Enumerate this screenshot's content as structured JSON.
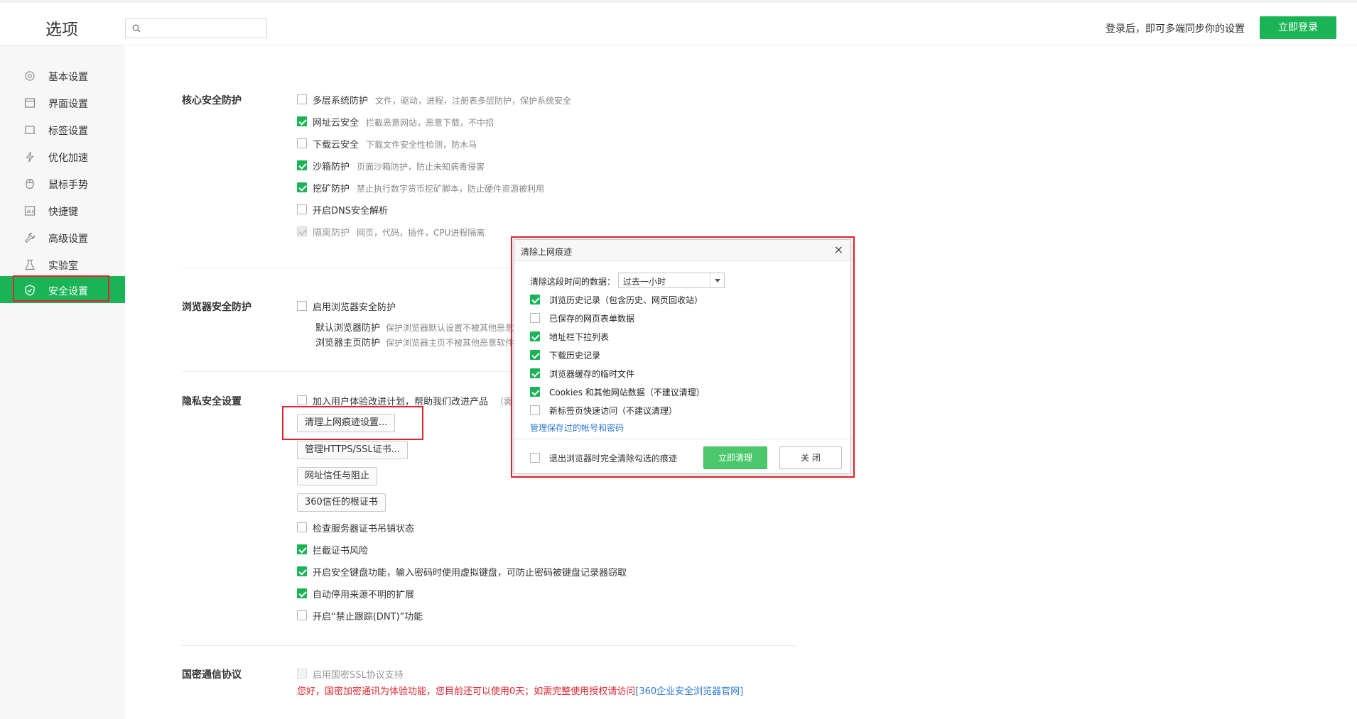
{
  "header": {
    "title": "选项",
    "search_placeholder": "",
    "login_hint": "登录后，即可多端同步你的设置",
    "login_button": "立即登录"
  },
  "sidebar": {
    "items": [
      {
        "label": "基本设置",
        "icon": "gear-icon"
      },
      {
        "label": "界面设置",
        "icon": "window-icon"
      },
      {
        "label": "标签设置",
        "icon": "tab-icon"
      },
      {
        "label": "优化加速",
        "icon": "lightning-icon"
      },
      {
        "label": "鼠标手势",
        "icon": "mouse-icon"
      },
      {
        "label": "快捷键",
        "icon": "keyboard-icon"
      },
      {
        "label": "高级设置",
        "icon": "wrench-icon"
      },
      {
        "label": "实验室",
        "icon": "flask-icon"
      },
      {
        "label": "安全设置",
        "icon": "shield-icon",
        "active": true
      }
    ]
  },
  "core": {
    "title": "核心安全防护",
    "options": [
      {
        "label": "多层系统防护",
        "desc": "文件，驱动，进程，注册表多层防护，保护系统安全",
        "checked": false
      },
      {
        "label": "网址云安全",
        "desc": "拦截恶意网站，恶意下载，不中招",
        "checked": true
      },
      {
        "label": "下载云安全",
        "desc": "下载文件安全性检测，防木马",
        "checked": false
      },
      {
        "label": "沙箱防护",
        "desc": "页面沙箱防护，防止未知病毒侵害",
        "checked": true
      },
      {
        "label": "挖矿防护",
        "desc": "禁止执行数字货币挖矿脚本，防止硬件资源被利用",
        "checked": true
      },
      {
        "label": "开启DNS安全解析",
        "desc": "",
        "checked": false
      },
      {
        "label": "隔离防护",
        "desc": "网页，代码，插件，CPU进程隔离",
        "checked": true,
        "disabled": true
      }
    ]
  },
  "browser": {
    "title": "浏览器安全防护",
    "enable_label": "启用浏览器安全防护",
    "sub": [
      {
        "label": "默认浏览器防护",
        "desc": "保护浏览器默认设置不被其他恶意"
      },
      {
        "label": "浏览器主页防护",
        "desc": "保护浏览器主页不被其他恶意软件"
      }
    ]
  },
  "privacy": {
    "title": "隐私安全设置",
    "join_label": "加入用户体验改进计划，帮助我们改进产品",
    "join_suffix": "（需",
    "buttons": [
      "清理上网痕迹设置...",
      "管理HTTPS/SSL证书...",
      "网址信任与阻止",
      "360信任的根证书"
    ],
    "options": [
      {
        "label": "检查服务器证书吊销状态",
        "checked": false
      },
      {
        "label": "拦截证书风险",
        "checked": true
      },
      {
        "label": "开启安全键盘功能，输入密码时使用虚拟键盘，可防止密码被键盘记录器窃取",
        "checked": true
      },
      {
        "label": "自动停用来源不明的扩展",
        "checked": true
      },
      {
        "label": "开启“禁止跟踪(DNT)”功能",
        "checked": false
      }
    ]
  },
  "gm": {
    "title": "国密通信协议",
    "option_label": "启用国密SSL协议支持",
    "warning": "您好，国密加密通讯为体验功能，您目前还可以使用0天；如需完整使用授权请访问",
    "warning_link": "[360企业安全浏览器官网]"
  },
  "dialog": {
    "title": "清除上网痕迹",
    "close": "×",
    "range_label": "清除这段时间的数据：",
    "range_value": "过去一小时",
    "items": [
      {
        "label": "浏览历史记录（包含历史、网页回收站）",
        "checked": true
      },
      {
        "label": "已保存的网页表单数据",
        "checked": false
      },
      {
        "label": "地址栏下拉列表",
        "checked": true
      },
      {
        "label": "下载历史记录",
        "checked": true
      },
      {
        "label": "浏览器缓存的临时文件",
        "checked": true
      },
      {
        "label": "Cookies 和其他网站数据（不建议清理）",
        "checked": true
      },
      {
        "label": "新标签页快速访问（不建议清理）",
        "checked": false
      }
    ],
    "manage_link": "管理保存过的帐号和密码",
    "exit_label": "退出浏览器时完全清除勾选的痕迹",
    "clear_button": "立即清理",
    "close_button": "关 闭"
  },
  "colors": {
    "accent": "#1ab457",
    "highlight": "#e0242e",
    "link": "#2e7ad6"
  }
}
